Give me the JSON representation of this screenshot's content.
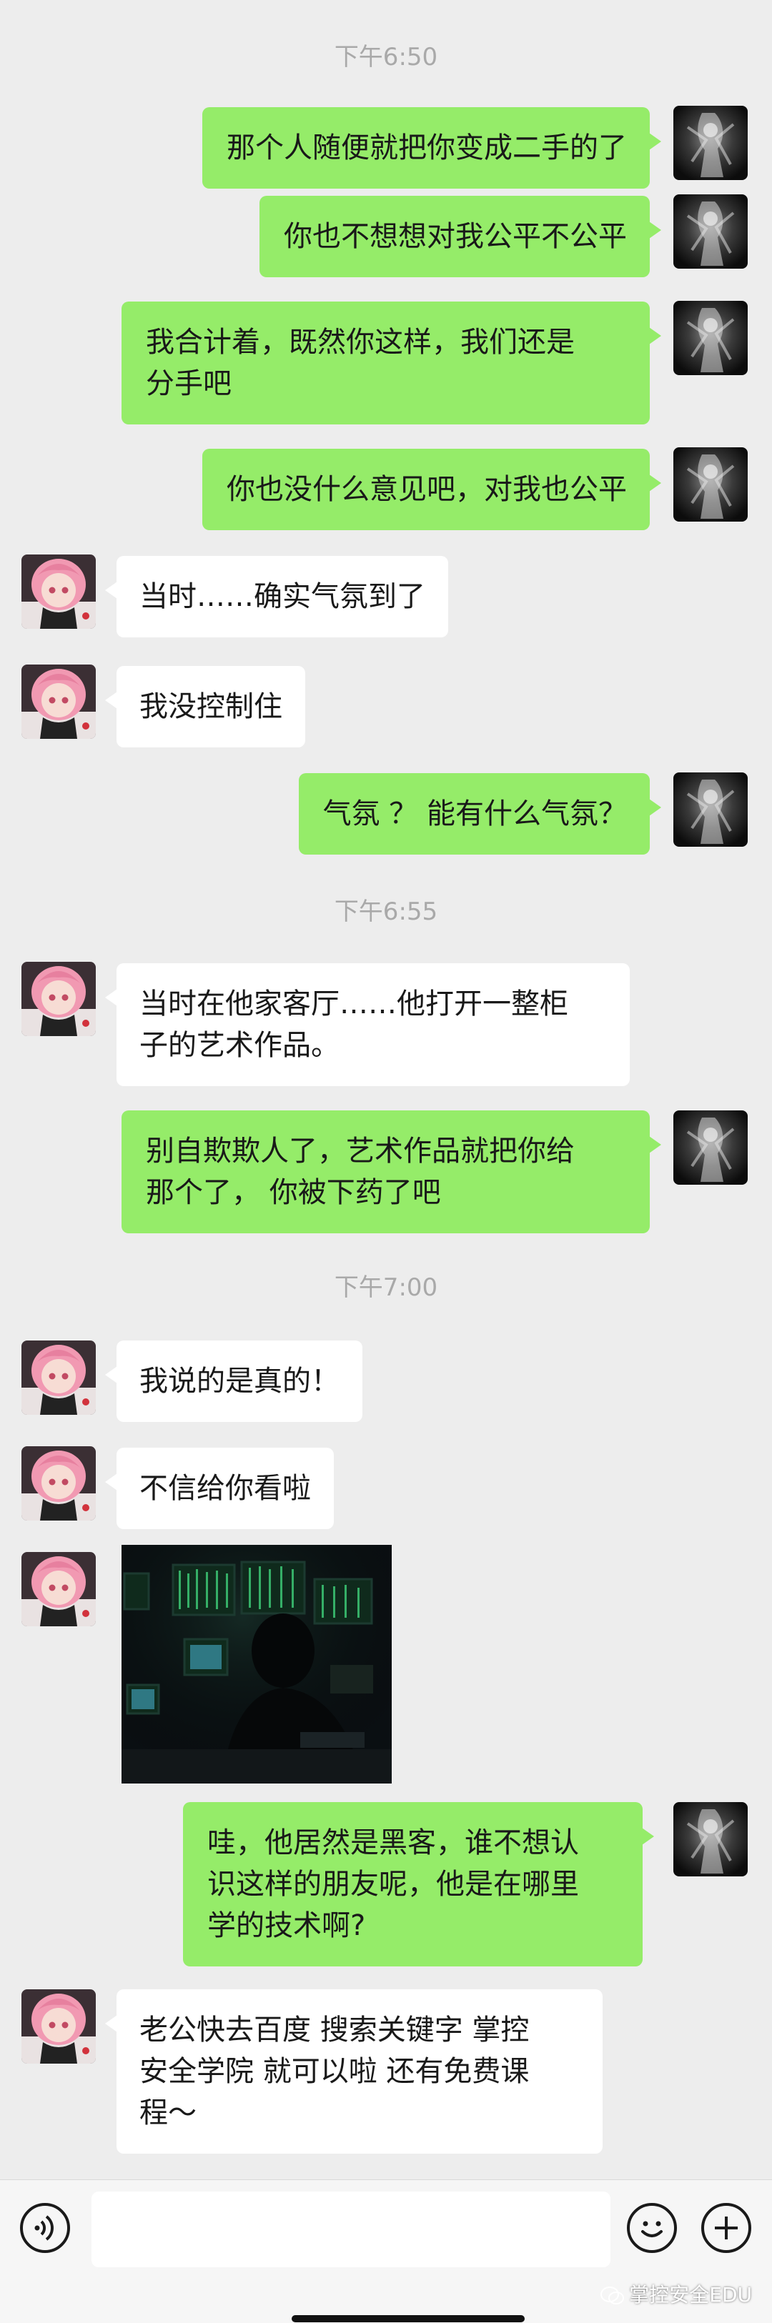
{
  "timestamps": [
    "下午6:50",
    "下午6:55",
    "下午7:00"
  ],
  "messages": [
    {
      "from": "me",
      "lines": [
        "那个人随便就把你变成二手的了"
      ]
    },
    {
      "from": "me",
      "lines": [
        "你也不想想对我公平不公平"
      ]
    },
    {
      "from": "me",
      "lines": [
        "我合计着，既然你这样，我们还是",
        "分手吧"
      ]
    },
    {
      "from": "me",
      "lines": [
        "你也没什么意见吧，对我也公平"
      ]
    },
    {
      "from": "them",
      "lines": [
        "当时……确实气氛到了"
      ]
    },
    {
      "from": "them",
      "lines": [
        "我没控制住"
      ]
    },
    {
      "from": "me",
      "lines": [
        "气氛 ？ 能有什么气氛？"
      ]
    },
    {
      "from": "them",
      "lines": [
        "当时在他家客厅……他打开一整柜",
        "子的艺术作品。"
      ]
    },
    {
      "from": "me",
      "lines": [
        "别自欺欺人了，艺术作品就把你给",
        "那个了， 你被下药了吧"
      ]
    },
    {
      "from": "them",
      "lines": [
        "我说的是真的！"
      ]
    },
    {
      "from": "them",
      "lines": [
        "不信给你看啦"
      ]
    },
    {
      "from": "them",
      "type": "image",
      "description": "hacker-photo"
    },
    {
      "from": "me",
      "lines": [
        "哇，他居然是黑客，谁不想认",
        "识这样的朋友呢，他是在哪里",
        "学的技术啊?"
      ]
    },
    {
      "from": "them",
      "lines": [
        "老公快去百度 搜索关键字 掌控",
        "安全学院 就可以啦 还有免费课",
        "程～"
      ]
    }
  ],
  "input_bar": {
    "voice_icon": "voice-icon",
    "emoji_icon": "emoji-icon",
    "plus_icon": "plus-icon",
    "input_value": ""
  },
  "watermark": "掌控安全EDU",
  "colors": {
    "background": "#ededed",
    "my_bubble": "#95ec69",
    "their_bubble": "#ffffff",
    "timestamp": "#a9a9a9"
  }
}
